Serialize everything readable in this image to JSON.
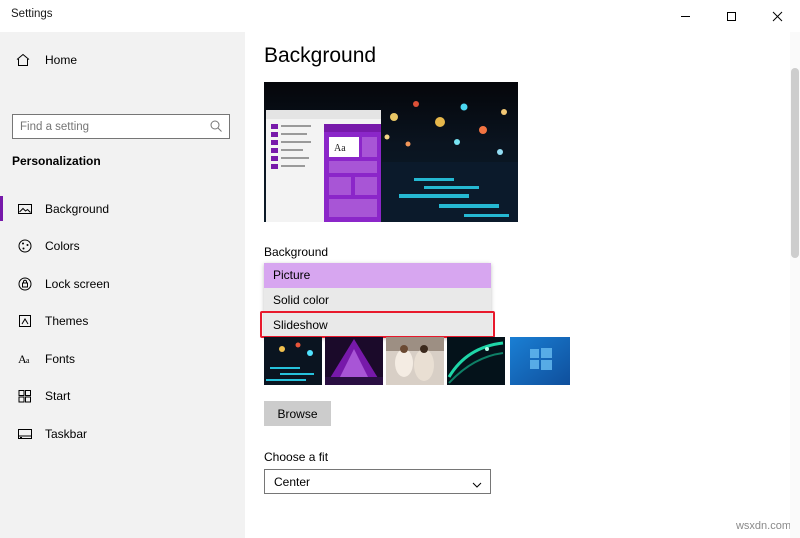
{
  "window": {
    "title": "Settings",
    "controls": {
      "minimize": "minimize-icon",
      "maximize": "maximize-icon",
      "close": "close-icon"
    }
  },
  "sidebar": {
    "home_label": "Home",
    "home_icon": "home-icon",
    "search": {
      "placeholder": "Find a setting",
      "value": "",
      "icon": "search-icon"
    },
    "section_label": "Personalization",
    "items": [
      {
        "label": "Background",
        "icon": "picture-icon",
        "selected": true
      },
      {
        "label": "Colors",
        "icon": "palette-icon",
        "selected": false
      },
      {
        "label": "Lock screen",
        "icon": "lock-screen-icon",
        "selected": false
      },
      {
        "label": "Themes",
        "icon": "brush-icon",
        "selected": false
      },
      {
        "label": "Fonts",
        "icon": "font-icon",
        "selected": false
      },
      {
        "label": "Start",
        "icon": "start-icon",
        "selected": false
      },
      {
        "label": "Taskbar",
        "icon": "taskbar-icon",
        "selected": false
      }
    ]
  },
  "main": {
    "page_title": "Background",
    "preview_alt": "desktop-preview",
    "preview_sample_text": "Aa",
    "background_label": "Background",
    "background_options": [
      {
        "label": "Picture",
        "state": "highlighted"
      },
      {
        "label": "Solid color",
        "state": "normal"
      },
      {
        "label": "Slideshow",
        "state": "focused"
      }
    ],
    "recent_images_label": "recent-image-thumbnails",
    "browse_label": "Browse",
    "choose_fit_label": "Choose a fit",
    "choose_fit_value": "Center",
    "fit_chevron": "chevron-down-icon"
  },
  "watermark": "wsxdn.com",
  "colors": {
    "accent": "#7719aa",
    "highlight": "#d7a6f0",
    "focus_outline": "#e8192c",
    "nav_bg": "#f2f2f2"
  }
}
